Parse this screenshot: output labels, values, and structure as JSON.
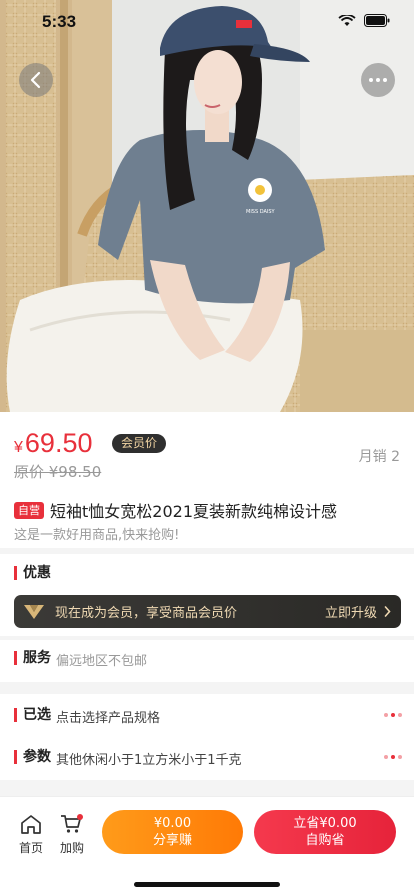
{
  "status": {
    "time": "5:33"
  },
  "product": {
    "price_symbol": "¥",
    "price": "69.50",
    "member_tag": "会员价",
    "original_price": "原价 ¥98.50",
    "monthly_sales": "月销 2",
    "self_tag": "自营",
    "title": "短袖t恤女宽松2021夏装新款纯棉设计感",
    "subtitle": "这是一款好用商品,快来抢购!",
    "print_text": "MISS DAISY"
  },
  "promo": {
    "label": "优惠",
    "vip_text": "现在成为会员，享受商品会员价",
    "vip_action": "立即升级"
  },
  "service": {
    "label": "服务",
    "value": "偏远地区不包邮"
  },
  "specs": {
    "selected_label": "已选",
    "selected_value": "点击选择产品规格",
    "params_label": "参数",
    "params_value": "其他休闲小于1立方米小于1千克"
  },
  "bottom": {
    "home_label": "首页",
    "cart_label": "加购",
    "share_price": "¥0.00",
    "share_label": "分享赚",
    "buy_price": "立省¥0.00",
    "buy_label": "自购省"
  },
  "colors": {
    "accent": "#e8303b",
    "share": "#ff8a10",
    "vip_gold": "#efd9b3"
  },
  "icons": [
    "back-icon",
    "more-icon",
    "home-icon",
    "cart-icon",
    "chevron-right-icon",
    "wifi-icon",
    "battery-icon",
    "signal-icon",
    "vip-logo-icon"
  ]
}
